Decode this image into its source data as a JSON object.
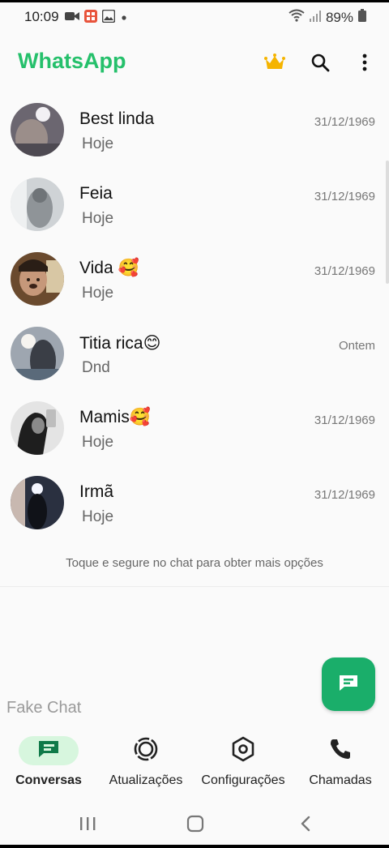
{
  "status_bar": {
    "time": "10:09",
    "battery": "89%"
  },
  "app_bar": {
    "title": "WhatsApp"
  },
  "chats": [
    {
      "name": "Best linda",
      "subtitle": "Hoje",
      "date": "31/12/1969"
    },
    {
      "name": "Feia",
      "subtitle": "Hoje",
      "date": "31/12/1969"
    },
    {
      "name": "Vida  🥰",
      "subtitle": "Hoje",
      "date": "31/12/1969"
    },
    {
      "name": "Titia rica😊",
      "subtitle": "Dnd",
      "date": "Ontem"
    },
    {
      "name": "Mamis🥰",
      "subtitle": "Hoje",
      "date": "31/12/1969"
    },
    {
      "name": "Irmã",
      "subtitle": "Hoje",
      "date": "31/12/1969"
    }
  ],
  "hint": "Toque e segure no chat para obter mais opções",
  "watermark": "Fake Chat",
  "bottom_nav": [
    {
      "label": "Conversas",
      "icon": "chat-icon",
      "active": true
    },
    {
      "label": "Atualizações",
      "icon": "status-icon",
      "active": false
    },
    {
      "label": "Configurações",
      "icon": "settings-icon",
      "active": false
    },
    {
      "label": "Chamadas",
      "icon": "phone-icon",
      "active": false
    }
  ],
  "colors": {
    "brand": "#25c06b",
    "fab": "#1aae6a",
    "active_pill": "#d7f6de",
    "premium_crown": "#f5b400"
  }
}
